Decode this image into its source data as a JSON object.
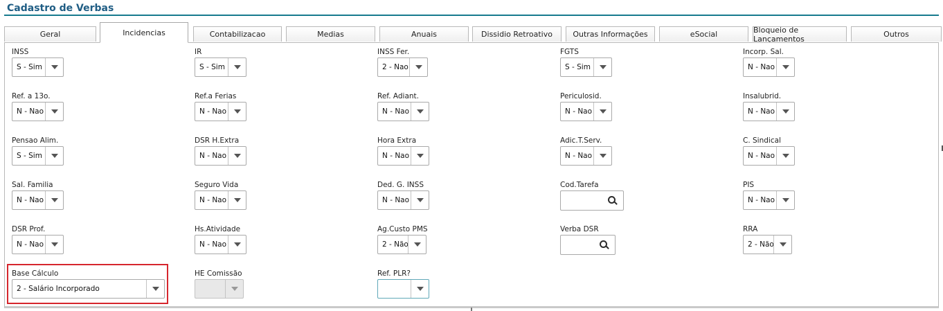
{
  "title": "Cadastro de Verbas",
  "tabs": [
    {
      "label": "Geral"
    },
    {
      "label": "Incidencias"
    },
    {
      "label": "Contabilizacao"
    },
    {
      "label": "Medias"
    },
    {
      "label": "Anuais"
    },
    {
      "label": "Dissidio Retroativo"
    },
    {
      "label": "Outras Informações"
    },
    {
      "label": "eSocial"
    },
    {
      "label": "Bloqueio de Lançamentos"
    },
    {
      "label": "Outros"
    }
  ],
  "active_tab": "Incidencias",
  "fields": {
    "inss": {
      "label": "INSS",
      "value": "S - Sim"
    },
    "ir": {
      "label": "IR",
      "value": "S - Sim"
    },
    "inss_fer": {
      "label": "INSS Fer.",
      "value": "2 - Nao"
    },
    "fgts": {
      "label": "FGTS",
      "value": "S - Sim"
    },
    "incorp_sal": {
      "label": "Incorp. Sal.",
      "value": "N - Nao"
    },
    "ref_13": {
      "label": "Ref. a 13o.",
      "value": "N - Nao"
    },
    "ref_ferias": {
      "label": "Ref.a Ferias",
      "value": "N - Nao"
    },
    "ref_adiant": {
      "label": "Ref. Adiant.",
      "value": "N - Nao"
    },
    "periculosid": {
      "label": "Periculosid.",
      "value": "N - Nao"
    },
    "insalubrid": {
      "label": "Insalubrid.",
      "value": "N - Nao"
    },
    "pensao_alim": {
      "label": "Pensao Alim.",
      "value": "S - Sim"
    },
    "dsr_hextra": {
      "label": "DSR H.Extra",
      "value": "N - Nao"
    },
    "hora_extra": {
      "label": "Hora Extra",
      "value": "N - Nao"
    },
    "adic_tserv": {
      "label": "Adic.T.Serv.",
      "value": "N - Nao"
    },
    "c_sindical": {
      "label": "C. Sindical",
      "value": "N - Nao"
    },
    "sal_familia": {
      "label": "Sal. Familia",
      "value": "N - Nao"
    },
    "seguro_vida": {
      "label": "Seguro Vida",
      "value": "N - Nao"
    },
    "ded_g_inss": {
      "label": "Ded. G. INSS",
      "value": "N - Nao"
    },
    "cod_tarefa": {
      "label": "Cod.Tarefa",
      "value": ""
    },
    "pis": {
      "label": "PIS",
      "value": "N - Nao"
    },
    "dsr_prof": {
      "label": "DSR Prof.",
      "value": "N - Nao"
    },
    "hs_atividade": {
      "label": "Hs.Atividade",
      "value": "N - Nao"
    },
    "ag_custo_pms": {
      "label": "Ag.Custo PMS",
      "value": "2 - Não"
    },
    "verba_dsr": {
      "label": "Verba DSR",
      "value": ""
    },
    "rra": {
      "label": "RRA",
      "value": "2 - Não"
    },
    "base_calculo": {
      "label": "Base Cálculo",
      "value": "2 - Salário Incorporado"
    },
    "he_comissao": {
      "label": "HE Comissão",
      "value": ""
    },
    "ref_plr": {
      "label": "Ref. PLR?",
      "value": ""
    }
  },
  "colors": {
    "title": "#1f5d84",
    "title_rule": "#167a8e",
    "highlight": "#d6262d",
    "focus_border": "#5fa8b8"
  },
  "icons": {
    "dropdown": "chevron-down-icon",
    "lookup": "search-icon"
  }
}
